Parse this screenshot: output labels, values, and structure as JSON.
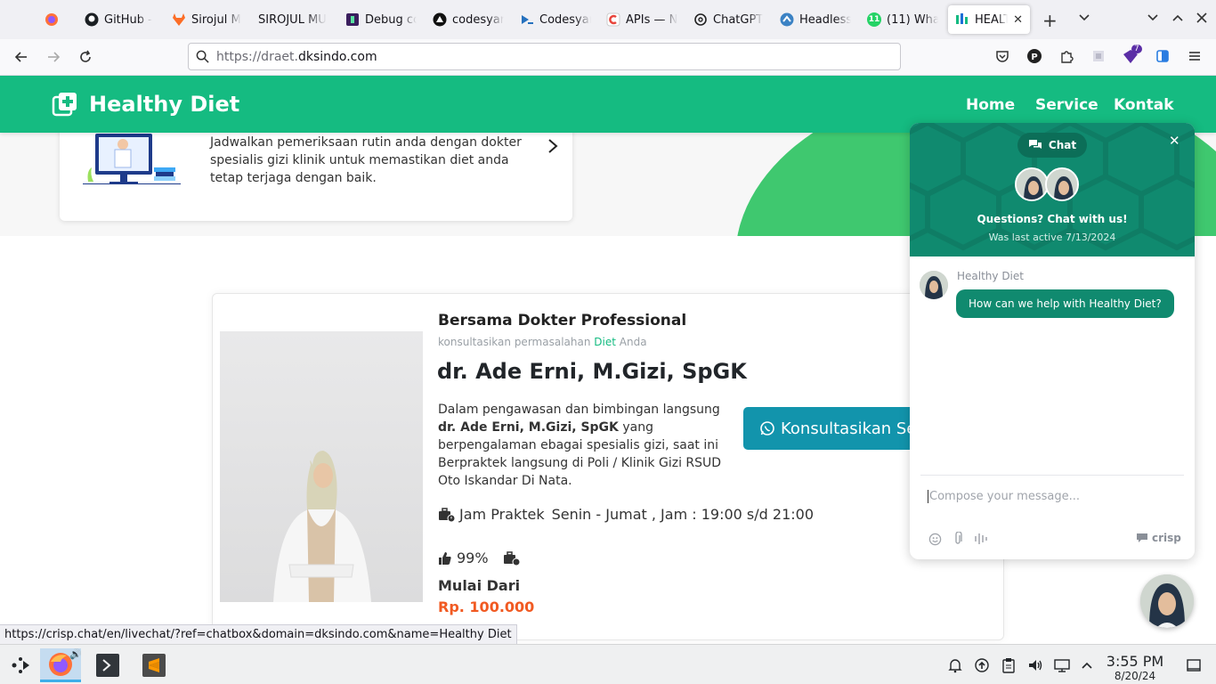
{
  "browser": {
    "tabs": [
      {
        "title": "",
        "icon": "firefox-icon"
      },
      {
        "title": "GitHub -",
        "icon": "github-icon"
      },
      {
        "title": "Sirojul M",
        "icon": "gitlab-icon"
      },
      {
        "title": "SIROJUL MU",
        "icon": ""
      },
      {
        "title": "Debug cc",
        "icon": "debug-icon"
      },
      {
        "title": "codesyar",
        "icon": "codesandbox-icon"
      },
      {
        "title": "Codesyar",
        "icon": "powershell-icon"
      },
      {
        "title": "APIs — N",
        "icon": "apis-icon"
      },
      {
        "title": "ChatGPT",
        "icon": "chatgpt-icon"
      },
      {
        "title": "Headless",
        "icon": "headless-icon"
      },
      {
        "title": "(11) Wha",
        "icon": "whatsapp-icon"
      },
      {
        "title": "HEALT",
        "icon": "healthy-diet-icon"
      }
    ],
    "whatsapp_badge": "11",
    "url_scheme": "https://draet.",
    "url_domain": "dksindo.com",
    "extension_badge": "7",
    "status_url": "https://crisp.chat/en/livechat/?ref=chatbox&domain=dksindo.com&name=Healthy Diet"
  },
  "site": {
    "brand": "Healthy Diet",
    "nav": [
      "Home",
      "Service",
      "Kontak"
    ],
    "service_desc": "Jadwalkan pemeriksaan rutin anda dengan dokter spesialis gizi klinik untuk memastikan diet anda tetap terjaga dengan baik.",
    "heading": "Bersama Dokter Professional",
    "sub_prefix": "konsultasikan permasalahan",
    "sub_highlight": "Diet",
    "sub_suffix": "Anda",
    "doctor_name": "dr. Ade Erni, M.Gizi, SpGK",
    "desc_prefix": "Dalam pengawasan dan bimbingan langsung",
    "desc_bold": "dr. Ade Erni, M.Gizi, SpGK",
    "desc_suffix": "yang berpengalaman ebagai spesialis gizi, saat ini Berpraktek langsung di Poli / Klinik Gizi RSUD Oto Iskandar Di Nata.",
    "consult_button": "Konsultasikan Se",
    "jam_label": "Jam Praktek",
    "jam_value": "Senin - Jumat , Jam : 19:00 s/d 21:00",
    "rating": "99%",
    "mulai_label": "Mulai Dari",
    "price": "Rp. 100.000"
  },
  "chat": {
    "pill_label": "Chat",
    "title": "Questions? Chat with us!",
    "last_active": "Was last active 7/13/2024",
    "sender": "Healthy Diet",
    "message": "How can we help with Healthy Diet?",
    "placeholder": "Compose your message...",
    "brand": "crisp"
  },
  "taskbar": {
    "time": "3:55 PM",
    "date": "8/20/24"
  },
  "colors": {
    "brand_green": "#15bb81",
    "chat_teal": "#108a6f",
    "consult_blue": "#1294ac",
    "price_orange": "#f15a22"
  }
}
